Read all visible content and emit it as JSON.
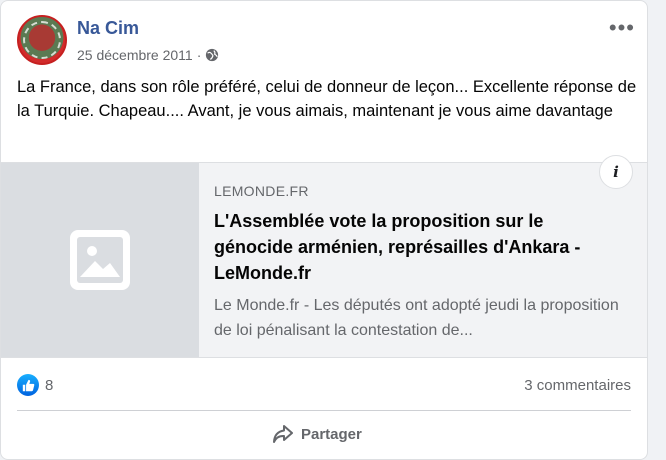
{
  "post": {
    "author": "Na Cim",
    "date": "25 décembre 2011",
    "separator": "·",
    "audience_icon": "globe-icon",
    "more_icon": "more-options-icon",
    "more_glyph": "•••",
    "text": "La France, dans son rôle préféré, celui de donneur de leçon... Excellente réponse de la Turquie. Chapeau.... Avant, je vous aimais, maintenant je vous aime davantage"
  },
  "link": {
    "domain": "LEMONDE.FR",
    "title": "L'Assemblée vote la proposition sur le génocide arménien, représailles d'Ankara - LeMonde.fr",
    "description": "Le Monde.fr - Les députés ont adopté jeudi la proposition de loi pénalisant la contestation de...",
    "info_glyph": "i",
    "thumbnail_icon": "image-placeholder-icon"
  },
  "stats": {
    "like_count": "8",
    "comments": "3 commentaires"
  },
  "actions": {
    "share_label": "Partager"
  },
  "colors": {
    "author": "#385898",
    "like_blue": "#0062df",
    "secondary_text": "#65676b"
  }
}
